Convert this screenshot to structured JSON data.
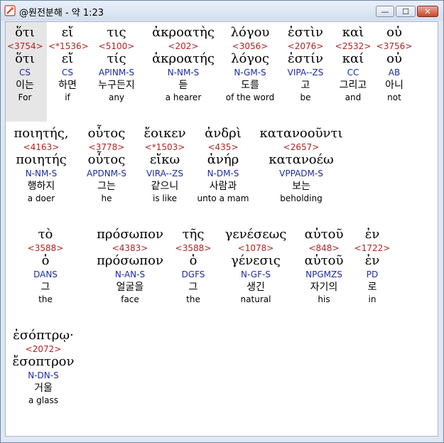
{
  "window": {
    "title": "@원전분해 - 약 1:23",
    "min_glyph": "—",
    "max_glyph": "☐",
    "close_glyph": "✕"
  },
  "tokens": [
    {
      "g": "ὅτι",
      "num": "<3754>",
      "lex": "ὅτι",
      "par": "CS",
      "ko": "이는",
      "en": "For"
    },
    {
      "g": "εἴ",
      "num": "<*1536>",
      "lex": "εἴ",
      "par": "CS",
      "ko": "하면",
      "en": "if"
    },
    {
      "g": "τις",
      "num": "<5100>",
      "lex": "τίς",
      "par": "APINM-S",
      "ko": "누구든지",
      "en": "any"
    },
    {
      "g": "ἀκροατὴς",
      "num": "<202>",
      "lex": "ἀκροατής",
      "par": "N-NM-S",
      "ko": "듣",
      "en": "a hearer"
    },
    {
      "g": "λόγου",
      "num": "<3056>",
      "lex": "λόγος",
      "par": "N-GM-S",
      "ko": "도를",
      "en": "of the word"
    },
    {
      "g": "ἐστὶν",
      "num": "<2076>",
      "lex": "ἐστίν",
      "par": "VIPA--ZS",
      "ko": "고",
      "en": "be"
    },
    {
      "g": "καὶ",
      "num": "<2532>",
      "lex": "καί",
      "par": "CC",
      "ko": "그리고",
      "en": "and"
    },
    {
      "g": "οὐ",
      "num": "<3756>",
      "lex": "οὐ",
      "par": "AB",
      "ko": "아니",
      "en": "not"
    },
    {
      "g": "ποιητής,",
      "num": "<4163>",
      "lex": "ποιητής",
      "par": "N-NM-S",
      "ko": "행하지",
      "en": "a doer"
    },
    {
      "g": "οὗτος",
      "num": "<3778>",
      "lex": "οὗτος",
      "par": "APDNM-S",
      "ko": "그는",
      "en": "he"
    },
    {
      "g": "ἔοικεν",
      "num": "<*1503>",
      "lex": "εἴκω",
      "par": "VIRA--ZS",
      "ko": "같으니",
      "en": "is like"
    },
    {
      "g": "ἀνδρὶ",
      "num": "<435>",
      "lex": "ἀνήρ",
      "par": "N-DM-S",
      "ko": "사람과",
      "en": "unto a mam"
    },
    {
      "g": "κατανοοῦντι",
      "num": "<2657>",
      "lex": "κατανοέω",
      "par": "VPPADM-S",
      "ko": "보는",
      "en": "beholding"
    },
    {
      "g": "τὸ",
      "num": "<3588>",
      "lex": "ὁ",
      "par": "DANS",
      "ko": "그",
      "en": "the"
    },
    {
      "g": "πρόσωπον",
      "num": "<4383>",
      "lex": "πρόσωπον",
      "par": "N-AN-S",
      "ko": "얼굴을",
      "en": "face"
    },
    {
      "g": "τῆς",
      "num": "<3588>",
      "lex": "ὁ",
      "par": "DGFS",
      "ko": "그",
      "en": "the"
    },
    {
      "g": "γενέσεως",
      "num": "<1078>",
      "lex": "γένεσις",
      "par": "N-GF-S",
      "ko": "생긴",
      "en": "natural"
    },
    {
      "g": "αὐτοῦ",
      "num": "<848>",
      "lex": "αὑτοῦ",
      "par": "NPGMZS",
      "ko": "자기의",
      "en": "his"
    },
    {
      "g": "ἐν",
      "num": "<1722>",
      "lex": "ἐν",
      "par": "PD",
      "ko": "로",
      "en": "in"
    },
    {
      "g": "ἐσόπτρῳ·",
      "num": "<2072>",
      "lex": "ἔσοπτρον",
      "par": "N-DN-S",
      "ko": "거울",
      "en": "a glass"
    }
  ]
}
